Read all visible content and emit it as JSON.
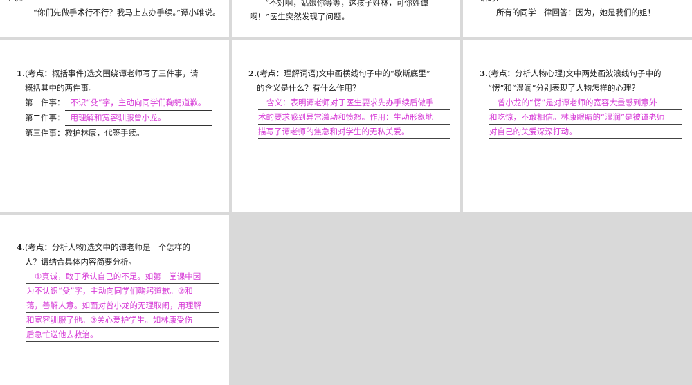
{
  "top": {
    "p1_line1": "生说。",
    "p1_line2": "“你们先做手术行不行？我马上去办手续。”谭小唯说。",
    "p2_line1": "“不对啊，姑娘你等等，这孩子姓林，可你姓谭",
    "p2_line2": "啊！”医生突然发现了问题。",
    "p3_line1": "错的？",
    "p3_line2": "所有的同学一律回答：因为，她是我们的姐！"
  },
  "q1": {
    "num": "1.",
    "text1": "(考点：概括事件)选文围绕谭老师写了三件事，请",
    "text2": "概括其中的两件事。",
    "item1_label": "第一件事：",
    "item1_answer": "不识“殳”字，主动向同学们鞠躬道歉。",
    "item2_label": "第二件事：",
    "item2_answer": "用理解和宽容驯服曾小龙。",
    "item3": "第三件事：救护林康，代签手续。"
  },
  "q2": {
    "num": "2.",
    "text1": "(考点：理解词语)文中画横线句子中的“歇斯底里”",
    "text2": "的含义是什么？有什么作用？",
    "answer_lines": [
      "含义：表明谭老师对于医生要求先办手续后做手",
      "术的要求感到异常激动和愤怒。作用：生动形象地",
      "描写了谭老师的焦急和对学生的无私关爱。"
    ]
  },
  "q3": {
    "num": "3.",
    "text1": "(考点：分析人物心理)文中两处画波浪线句子中的",
    "text2": "“愣”和“湿润”分别表现了人物怎样的心理？",
    "answer_lines": [
      "曾小龙的“愣”是对谭老师的宽容大量感到意外",
      "和吃惊，不敢相信。林康眼睛的“湿润”是被谭老师",
      "对自己的关爱深深打动。"
    ]
  },
  "q4": {
    "num": "4.",
    "text1": "(考点：分析人物)选文中的谭老师是一个怎样的",
    "text2": "人？请结合具体内容简要分析。",
    "answer_lines": [
      "①真诚，敢于承认自己的不足。如第一堂课中因",
      "为不认识“殳”字，主动向同学们鞠躬道歉。②和",
      "蔼，善解人意。如面对曾小龙的无理取闹，用理解",
      "和宽容驯服了他。③关心爱护学生。如林康受伤",
      "后急忙送他去救治。"
    ]
  }
}
